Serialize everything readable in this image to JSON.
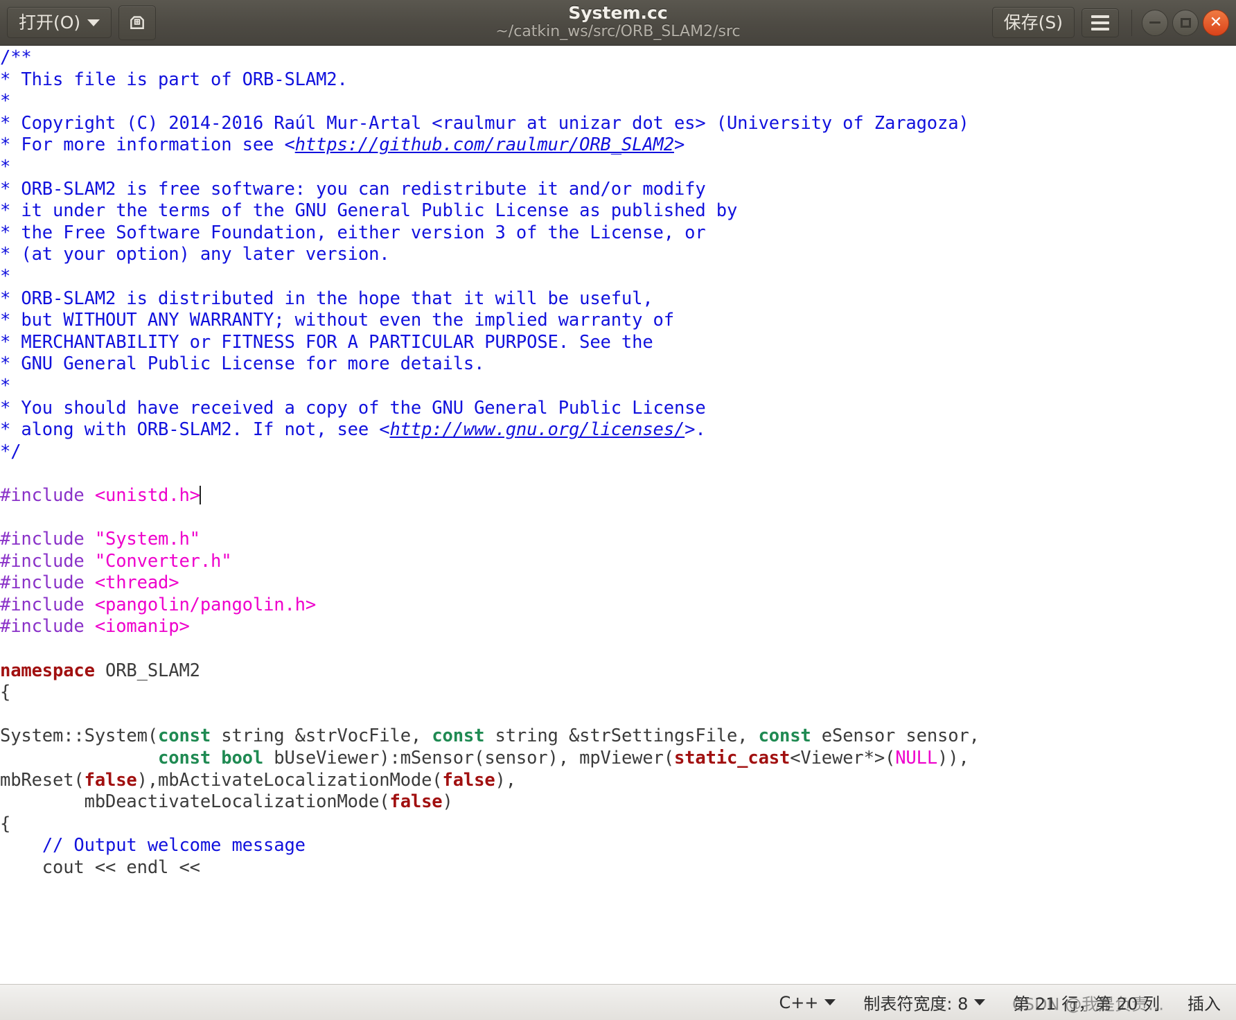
{
  "titlebar": {
    "open_button_label": "打开(O)",
    "open_button_icon": "chevron-down-icon",
    "save_as_icon": "save-as-icon",
    "title": "System.cc",
    "subtitle": "~/catkin_ws/src/ORB_SLAM2/src",
    "save_button_label": "保存(S)",
    "menu_icon": "hamburger-menu-icon",
    "minimize_icon": "minimize-icon",
    "maximize_icon": "maximize-icon",
    "close_icon": "close-icon"
  },
  "statusbar": {
    "language": "C++",
    "tab_width": "制表符宽度: 8",
    "cursor_position": "第 21 行，第 20 列",
    "insert_mode": "插入",
    "watermark": "CSDN @我是负责..."
  },
  "colors": {
    "titlebar_bg": "#4d4a43",
    "editor_bg": "#ffffff",
    "comment": "#1111dd",
    "preprocessor": "#8a32c8",
    "header_name": "#ee00cc",
    "keyword": "#a11010",
    "type_keyword": "#1f8a52",
    "plain_text": "#3b3b3b",
    "statusbar_bg": "#e9e7e3",
    "close_button": "#d9431a"
  },
  "code": {
    "lines": [
      "/**",
      "* This file is part of ORB-SLAM2.",
      "*",
      "* Copyright (C) 2014-2016 Raúl Mur-Artal <raulmur at unizar dot es> (University of Zaragoza)",
      "* For more information see <https://github.com/raulmur/ORB_SLAM2>",
      "*",
      "* ORB-SLAM2 is free software: you can redistribute it and/or modify",
      "* it under the terms of the GNU General Public License as published by",
      "* the Free Software Foundation, either version 3 of the License, or",
      "* (at your option) any later version.",
      "*",
      "* ORB-SLAM2 is distributed in the hope that it will be useful,",
      "* but WITHOUT ANY WARRANTY; without even the implied warranty of",
      "* MERCHANTABILITY or FITNESS FOR A PARTICULAR PURPOSE. See the",
      "* GNU General Public License for more details.",
      "*",
      "* You should have received a copy of the GNU General Public License",
      "* along with ORB-SLAM2. If not, see <http://www.gnu.org/licenses/>.",
      "*/",
      "",
      "#include <unistd.h>",
      "",
      "#include \"System.h\"",
      "#include \"Converter.h\"",
      "#include <thread>",
      "#include <pangolin/pangolin.h>",
      "#include <iomanip>",
      "",
      "namespace ORB_SLAM2",
      "{",
      "",
      "System::System(const string &strVocFile, const string &strSettingsFile, const eSensor sensor,",
      "               const bool bUseViewer):mSensor(sensor), mpViewer(static_cast<Viewer*>(NULL)),",
      "mbReset(false),mbActivateLocalizationMode(false),",
      "        mbDeactivateLocalizationMode(false)",
      "{",
      "    // Output welcome message",
      "    cout << endl <<"
    ],
    "urls": [
      "https://github.com/raulmur/ORB_SLAM2",
      "http://www.gnu.org/licenses/"
    ]
  }
}
